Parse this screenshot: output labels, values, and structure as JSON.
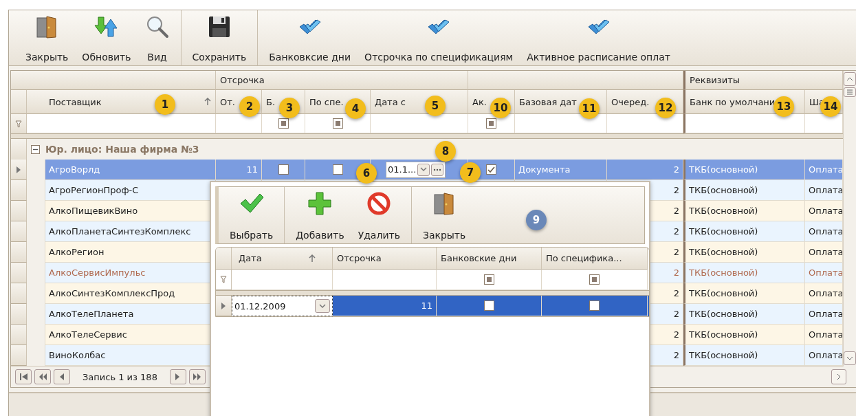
{
  "toolbar": {
    "groups": [
      {
        "buttons": [
          {
            "label": "Закрыть",
            "kind": "door"
          },
          {
            "label": "Обновить",
            "kind": "refresh"
          },
          {
            "label": "Вид",
            "kind": "search"
          }
        ]
      },
      {
        "buttons": [
          {
            "label": "Сохранить",
            "kind": "save"
          }
        ]
      },
      {
        "buttons": [
          {
            "label": "Банковксие дни",
            "kind": "checks"
          },
          {
            "label": "Отсрочка по спецификациям",
            "kind": "checks"
          },
          {
            "label": "Активное расписание оплат",
            "kind": "checks"
          }
        ]
      }
    ]
  },
  "grid": {
    "bands": [
      {
        "label": "Отсрочка"
      },
      {
        "label": "Реквизиты"
      }
    ],
    "columns": [
      {
        "label": "Поставщик",
        "kind": "text",
        "sorted": true
      },
      {
        "label": "От.",
        "kind": "number"
      },
      {
        "label": "Б.",
        "kind": "check",
        "sorted": false,
        "filter_indeterminate": true
      },
      {
        "label": "По спе.",
        "kind": "check",
        "sorted": false,
        "filter_indeterminate": true
      },
      {
        "label": "Дата с",
        "kind": "date",
        "sorted": false
      },
      {
        "label": "Ак.",
        "kind": "check",
        "sorted": false,
        "filter_indeterminate": true
      },
      {
        "label": "Базовая дат",
        "kind": "text",
        "sorted": false
      },
      {
        "label": "Очеред.",
        "kind": "number",
        "sorted": false
      },
      {
        "label": "Банк по умолчани",
        "kind": "text",
        "sorted": false
      },
      {
        "label": "Ша",
        "kind": "text"
      }
    ],
    "group": {
      "label": "Юр. лицо: Наша фирма №3",
      "expanded": true
    },
    "rows": [
      {
        "selected": true,
        "inactive": false,
        "cells": [
          "АгроВорлд",
          "11",
          {
            "checked": false
          },
          {
            "checked": false
          },
          "01.1...",
          {
            "checked": true
          },
          "Документа",
          "2",
          "ТКБ(основной)",
          "Оплата"
        ]
      },
      {
        "selected": false,
        "inactive": false,
        "cells": [
          "АгроРегионПроф-С",
          null,
          null,
          null,
          null,
          null,
          null,
          "2",
          "ТКБ(основной)",
          "Оплата"
        ]
      },
      {
        "selected": false,
        "inactive": false,
        "cells": [
          "АлкоПищевикВино",
          null,
          null,
          null,
          null,
          null,
          null,
          "2",
          "ТКБ(основной)",
          "Оплата"
        ]
      },
      {
        "selected": false,
        "inactive": false,
        "cells": [
          "АлкоПланетаСинтезКомплекс",
          null,
          null,
          null,
          null,
          null,
          null,
          "2",
          "ТКБ(основной)",
          "Оплата"
        ]
      },
      {
        "selected": false,
        "inactive": false,
        "cells": [
          "АлкоРегион",
          null,
          null,
          null,
          null,
          null,
          null,
          "2",
          "ТКБ(основной)",
          "Оплата"
        ]
      },
      {
        "selected": false,
        "inactive": true,
        "cells": [
          "АлкоСервисИмпульс",
          null,
          null,
          null,
          null,
          null,
          null,
          "2",
          "ТКБ(основной)",
          "Оплата"
        ]
      },
      {
        "selected": false,
        "inactive": false,
        "cells": [
          "АлкоСинтезКомплексПрод",
          null,
          null,
          null,
          null,
          null,
          null,
          "2",
          "ТКБ(основной)",
          "Оплата"
        ]
      },
      {
        "selected": false,
        "inactive": false,
        "cells": [
          "АлкоТелеПланета",
          null,
          null,
          null,
          null,
          null,
          null,
          "2",
          "ТКБ(основной)",
          "Оплата"
        ]
      },
      {
        "selected": false,
        "inactive": false,
        "cells": [
          "АлкоТелеСервис",
          null,
          null,
          null,
          null,
          null,
          null,
          "2",
          "ТКБ(основной)",
          "Оплата"
        ]
      },
      {
        "selected": false,
        "inactive": false,
        "cells": [
          "ВиноКолбас",
          null,
          null,
          null,
          null,
          null,
          null,
          "2",
          "ТКБ(основной)",
          "Оплата"
        ]
      }
    ],
    "navigator": {
      "record": "Запись 1 из 188"
    }
  },
  "popup": {
    "toolbar": {
      "groups": [
        {
          "buttons": [
            {
              "label": "Выбрать",
              "kind": "check"
            }
          ]
        },
        {
          "buttons": [
            {
              "label": "Добавить",
              "kind": "plus"
            },
            {
              "label": "Удалить",
              "kind": "forbid"
            }
          ]
        },
        {
          "buttons": [
            {
              "label": "Закрыть",
              "kind": "door"
            }
          ]
        }
      ]
    },
    "columns": [
      {
        "label": "Дата",
        "kind": "date",
        "sorted": true
      },
      {
        "label": "Отсрочка",
        "kind": "number",
        "sorted": false
      },
      {
        "label": "Банковские дни",
        "kind": "check",
        "sorted": false,
        "filter_indeterminate": true
      },
      {
        "label": "По специфика...",
        "kind": "check",
        "sorted": false,
        "filter_indeterminate": true
      }
    ],
    "rows": [
      {
        "selected": true,
        "cells": [
          "01.12.2009",
          "11",
          {
            "checked": false
          },
          {
            "checked": false
          }
        ]
      }
    ]
  },
  "callouts": [
    {
      "label": "1",
      "color": "#f2bd1c"
    },
    {
      "label": "2",
      "color": "#f2bd1c"
    },
    {
      "label": "3",
      "color": "#f2bd1c"
    },
    {
      "label": "4",
      "color": "#f2bd1c"
    },
    {
      "label": "5",
      "color": "#f2bd1c"
    },
    {
      "label": "6",
      "color": "#f2bd1c"
    },
    {
      "label": "7",
      "color": "#f2bd1c"
    },
    {
      "label": "8",
      "color": "#f2bd1c"
    },
    {
      "label": "9",
      "color": "#6a88b8"
    },
    {
      "label": "10",
      "color": "#f2bd1c"
    },
    {
      "label": "11",
      "color": "#f2bd1c"
    },
    {
      "label": "12",
      "color": "#f2bd1c"
    },
    {
      "label": "13",
      "color": "#f2bd1c"
    },
    {
      "label": "14",
      "color": "#f2bd1c"
    }
  ]
}
